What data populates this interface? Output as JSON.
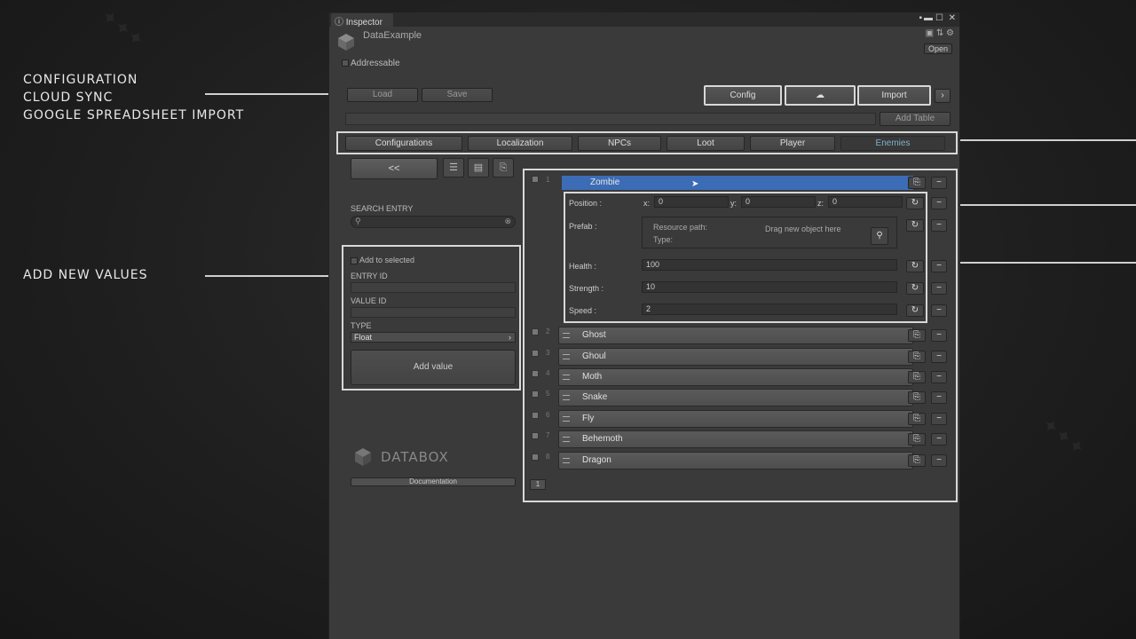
{
  "annotations": {
    "left_top": [
      "CONFIGURATION",
      "CLOUD SYNC",
      "GOOGLE SPREADSHEET IMPORT"
    ],
    "left_mid": "ADD NEW VALUES"
  },
  "window": {
    "tab_title": "Inspector",
    "object_name": "DataExample",
    "open_label": "Open",
    "addressable_label": "Addressable"
  },
  "toolbar": {
    "load_label": "Load",
    "save_label": "Save",
    "config_label": "Config",
    "cloud_label": "☁",
    "import_label": "Import",
    "add_table_label": "Add Table"
  },
  "tabs": [
    "Configurations",
    "Localization",
    "NPCs",
    "Loot",
    "Player",
    "Enemies"
  ],
  "active_tab": "Enemies",
  "left_panel": {
    "back_label": "<<",
    "search_label": "SEARCH ENTRY",
    "add_to_selected_label": "Add to selected",
    "entry_id_label": "ENTRY ID",
    "value_id_label": "VALUE ID",
    "type_label": "TYPE",
    "type_value": "Float",
    "add_value_label": "Add value",
    "logo_text": "DATABOX",
    "documentation_label": "Documentation"
  },
  "expanded_entry": {
    "index": "1",
    "name": "Zombie",
    "position_label": "Position :",
    "x_label": "x:",
    "x_value": "0",
    "y_label": "y:",
    "y_value": "0",
    "z_label": "z:",
    "z_value": "0",
    "prefab_label": "Prefab :",
    "resource_path_label": "Resource path:",
    "type_label": "Type:",
    "drag_label": "Drag new object here",
    "health_label": "Health :",
    "health_value": "100",
    "strength_label": "Strength :",
    "strength_value": "10",
    "speed_label": "Speed :",
    "speed_value": "2"
  },
  "entries": [
    {
      "index": "2",
      "name": "Ghost"
    },
    {
      "index": "3",
      "name": "Ghoul"
    },
    {
      "index": "4",
      "name": "Moth"
    },
    {
      "index": "5",
      "name": "Snake"
    },
    {
      "index": "6",
      "name": "Fly"
    },
    {
      "index": "7",
      "name": "Behemoth"
    },
    {
      "index": "8",
      "name": "Dragon"
    }
  ],
  "page_number": "1",
  "colors": {
    "selected_row": "#3c6cb5",
    "active_tab_text": "#7fb1c9",
    "highlight_frame": "#d8d8d8"
  }
}
